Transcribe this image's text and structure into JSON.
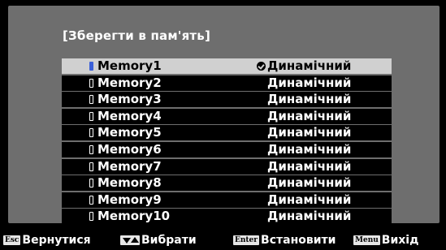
{
  "panel": {
    "title": "[Зберегти в пам'ять]"
  },
  "memories": [
    {
      "name": "Memory1",
      "mode": "Динамічний",
      "selected": true
    },
    {
      "name": "Memory2",
      "mode": "Динамічний",
      "selected": false
    },
    {
      "name": "Memory3",
      "mode": "Динамічний",
      "selected": false
    },
    {
      "name": "Memory4",
      "mode": "Динамічний",
      "selected": false
    },
    {
      "name": "Memory5",
      "mode": "Динамічний",
      "selected": false
    },
    {
      "name": "Memory6",
      "mode": "Динамічний",
      "selected": false
    },
    {
      "name": "Memory7",
      "mode": "Динамічний",
      "selected": false
    },
    {
      "name": "Memory8",
      "mode": "Динамічний",
      "selected": false
    },
    {
      "name": "Memory9",
      "mode": "Динамічний",
      "selected": false
    },
    {
      "name": "Memory10",
      "mode": "Динамічний",
      "selected": false
    }
  ],
  "icons": {
    "memory": "memory-slot-icon",
    "current": "checkmark-icon",
    "navigate": "up-down-arrows-icon"
  },
  "footer": {
    "back": {
      "key": "Esc",
      "label": "Вернутися"
    },
    "select": {
      "label": "Вибрати"
    },
    "set": {
      "key": "Enter",
      "label": "Встановити"
    },
    "exit": {
      "key": "Menu",
      "label": "Вихід"
    }
  },
  "colors": {
    "background": "#000000",
    "panel": "#6e6e6e",
    "selected_row": "#d0d0d0",
    "row": "#000000",
    "text": "#ffffff",
    "memory_icon_selected": "#3a5fd8"
  }
}
